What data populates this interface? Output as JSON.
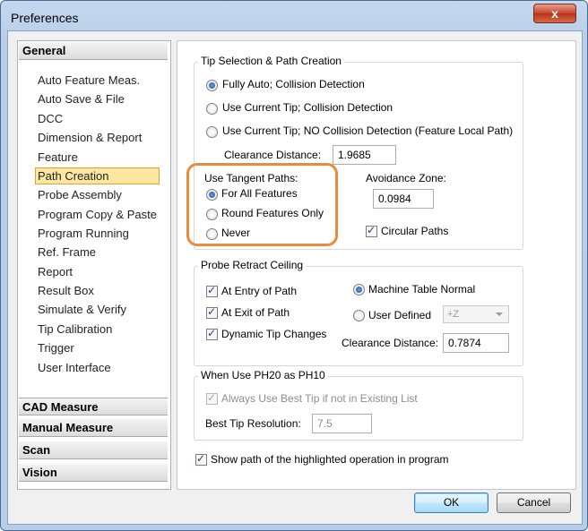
{
  "window": {
    "title": "Preferences",
    "close_glyph": "x"
  },
  "sidebar": {
    "sections": [
      {
        "label": "General"
      },
      {
        "label": "CAD Measure"
      },
      {
        "label": "Manual Measure"
      },
      {
        "label": "Scan"
      },
      {
        "label": "Vision"
      }
    ],
    "items": [
      {
        "label": "Auto Feature Meas."
      },
      {
        "label": "Auto Save & File"
      },
      {
        "label": "DCC"
      },
      {
        "label": "Dimension & Report"
      },
      {
        "label": "Feature"
      },
      {
        "label": "Path Creation",
        "selected": true
      },
      {
        "label": "Probe Assembly"
      },
      {
        "label": "Program Copy & Paste"
      },
      {
        "label": "Program Running"
      },
      {
        "label": "Ref. Frame"
      },
      {
        "label": "Report"
      },
      {
        "label": "Result Box"
      },
      {
        "label": "Simulate & Verify"
      },
      {
        "label": "Tip Calibration"
      },
      {
        "label": "Trigger"
      },
      {
        "label": "User Interface"
      }
    ]
  },
  "tip_selection": {
    "title": "Tip Selection & Path Creation",
    "options": [
      {
        "label": "Fully Auto; Collision Detection",
        "checked": true
      },
      {
        "label": "Use Current Tip; Collision Detection",
        "checked": false
      },
      {
        "label": "Use Current Tip; NO Collision Detection (Feature Local Path)",
        "checked": false
      }
    ],
    "clearance_label": "Clearance Distance:",
    "clearance_value": "1.9685",
    "tangent_label": "Use Tangent Paths:",
    "tangent_options": [
      {
        "label": "For All Features",
        "checked": true
      },
      {
        "label": "Round Features Only",
        "checked": false
      },
      {
        "label": "Never",
        "checked": false
      }
    ],
    "avoidance_label": "Avoidance Zone:",
    "avoidance_value": "0.0984",
    "circular_label": "Circular Paths",
    "circular_checked": true
  },
  "retract": {
    "title": "Probe Retract Ceiling",
    "entry_label": "At Entry of Path",
    "exit_label": "At Exit of Path",
    "dynamic_label": "Dynamic Tip Changes",
    "machine_table_label": "Machine Table Normal",
    "user_defined_label": "User Defined",
    "axis_value": "+Z",
    "clearance_label": "Clearance Distance:",
    "clearance_value": "0.7874"
  },
  "ph20": {
    "title": "When Use PH20 as PH10",
    "always_label": "Always Use Best Tip if not in Existing List",
    "resolution_label": "Best Tip Resolution:",
    "resolution_value": "7.5"
  },
  "show_path_label": "Show path of the highlighted operation in program",
  "buttons": {
    "ok": "OK",
    "cancel": "Cancel"
  },
  "colors": {
    "highlight": "#ec8a3c",
    "selection": "#fde7a2",
    "close": "#c7432b"
  }
}
